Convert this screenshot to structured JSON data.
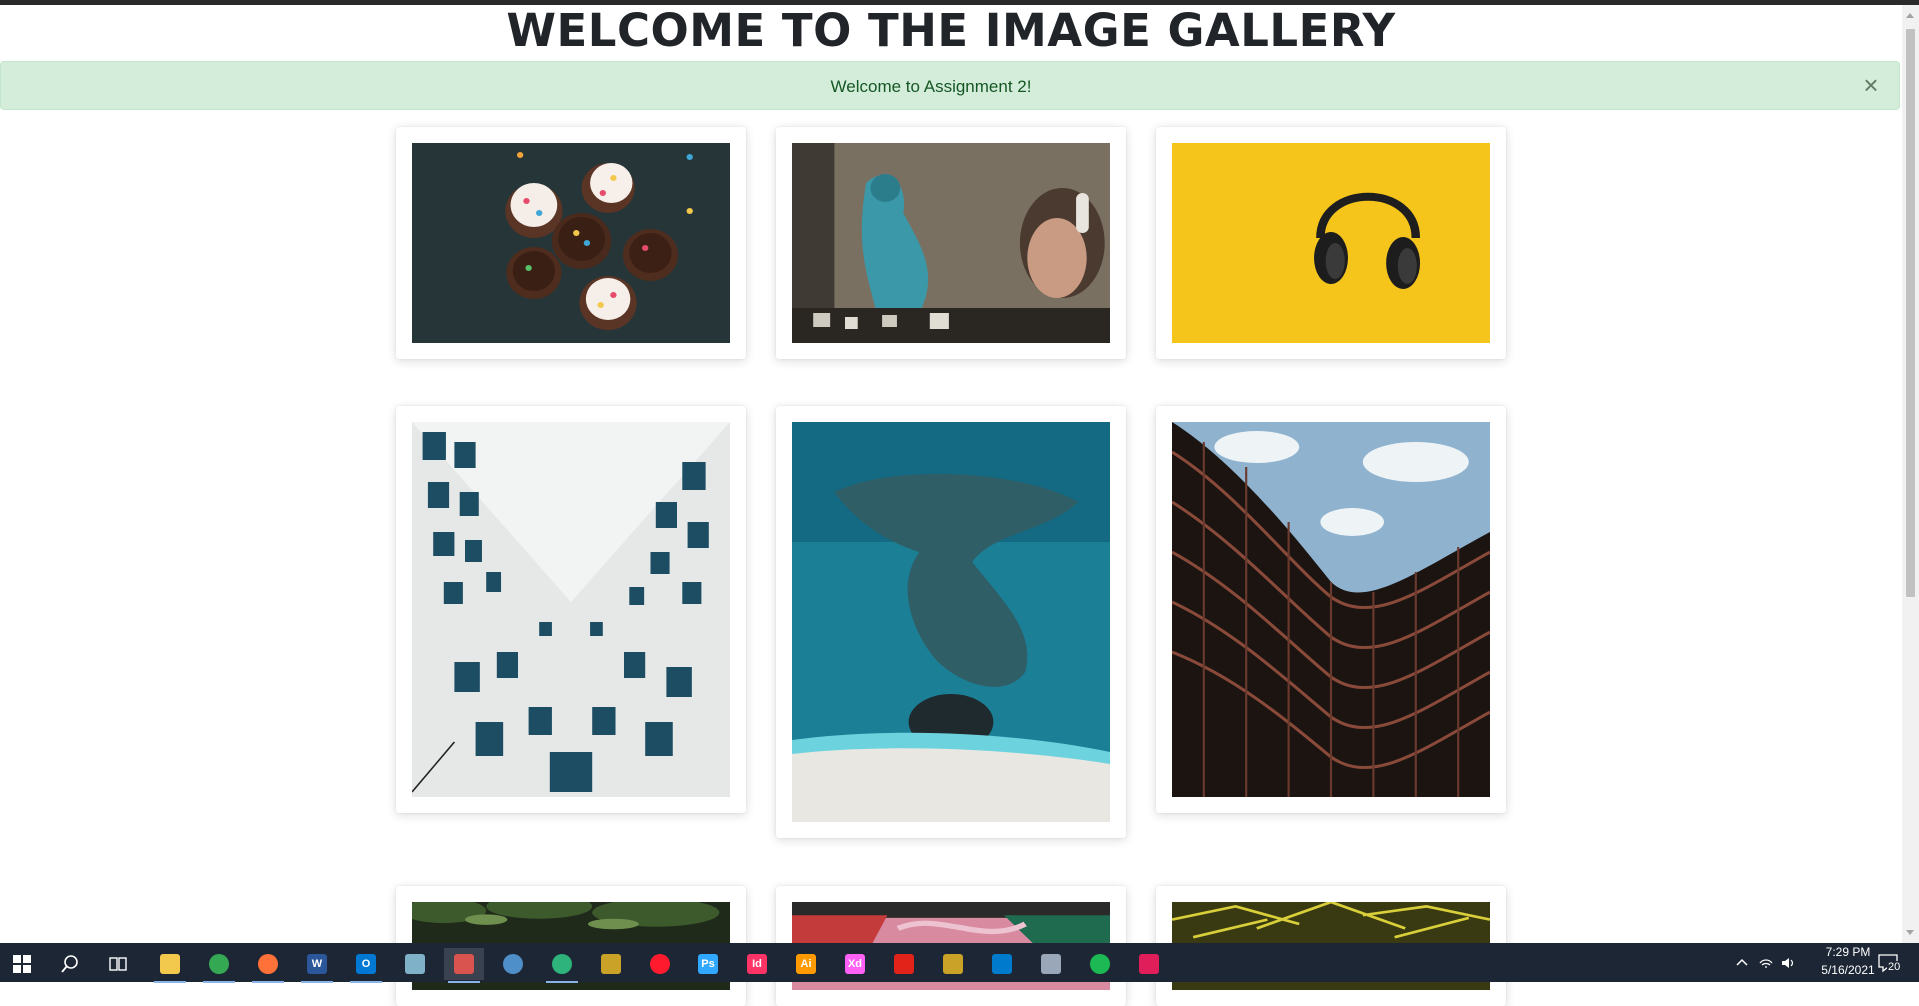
{
  "page": {
    "title": "WELCOME TO THE IMAGE GALLERY",
    "alert": {
      "message": "Welcome to Assignment 2!",
      "close_glyph": "×"
    }
  },
  "gallery": {
    "items": [
      {
        "name": "cupcakes"
      },
      {
        "name": "graffiti-woman-headphones"
      },
      {
        "name": "headphones-yellow"
      },
      {
        "name": "white-building-windows"
      },
      {
        "name": "aerial-sea-rocks"
      },
      {
        "name": "curved-building-sky"
      },
      {
        "name": "palm-trees"
      },
      {
        "name": "graffiti-pink"
      },
      {
        "name": "yellow-palms"
      }
    ]
  },
  "taskbar": {
    "icons": [
      {
        "name": "windows-start-icon"
      },
      {
        "name": "search-icon"
      },
      {
        "name": "task-view-icon"
      },
      {
        "name": "file-explorer-icon",
        "color": "#f2c94c"
      },
      {
        "name": "chrome-icon",
        "color": "#34a853"
      },
      {
        "name": "firefox-icon",
        "color": "#ff7139"
      },
      {
        "name": "word-icon",
        "color": "#2b579a",
        "label": "W"
      },
      {
        "name": "outlook-icon",
        "color": "#0078d4",
        "label": "O"
      },
      {
        "name": "sticky-app-icon",
        "color": "#7fb2c9"
      },
      {
        "name": "snipping-tool-icon",
        "color": "#d9534f"
      },
      {
        "name": "globe-app-icon",
        "color": "#4f8fc9"
      },
      {
        "name": "green-app-icon",
        "color": "#2db37b"
      },
      {
        "name": "gitkraken-icon",
        "color": "#c9a227"
      },
      {
        "name": "opera-icon",
        "color": "#ff1b2d"
      },
      {
        "name": "photoshop-icon",
        "color": "#31a8ff",
        "label": "Ps"
      },
      {
        "name": "indesign-icon",
        "color": "#ff3366",
        "label": "Id"
      },
      {
        "name": "illustrator-icon",
        "color": "#ff9a00",
        "label": "Ai"
      },
      {
        "name": "xd-icon",
        "color": "#ff61f6",
        "label": "Xd"
      },
      {
        "name": "acrobat-icon",
        "color": "#e2231a"
      },
      {
        "name": "sourcetree-icon",
        "color": "#c9a227"
      },
      {
        "name": "vscode-icon",
        "color": "#007acc"
      },
      {
        "name": "paint-icon",
        "color": "#9aa7b8"
      },
      {
        "name": "spotify-icon",
        "color": "#1db954"
      },
      {
        "name": "slack-icon",
        "color": "#e01e5a"
      }
    ],
    "tray": {
      "time": "7:29 PM",
      "date": "5/16/2021",
      "notifications": "20"
    }
  }
}
